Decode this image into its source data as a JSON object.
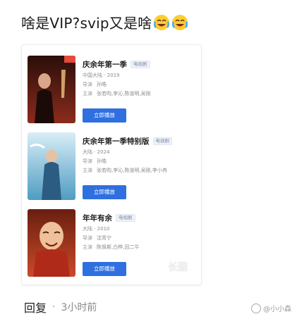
{
  "headline": "啥是VIP?svip又是啥",
  "items": [
    {
      "title": "庆余年第一季",
      "tag": "电视剧",
      "line1": "中国大陆 · 2019",
      "director_label": "导演",
      "director": "孙皓",
      "cast_label": "主演",
      "cast": "张若昀,李沁,陈道明,吴刚",
      "button": "立即播放",
      "poster_colors": [
        "#3a1410",
        "#7b2a1c"
      ]
    },
    {
      "title": "庆余年第一季特别版",
      "tag": "电视剧",
      "line1": "大陆 · 2024",
      "director_label": "导演",
      "director": "孙皓",
      "cast_label": "主演",
      "cast": "张若昀,李沁,陈道明,吴刚,李小冉",
      "button": "立即播放",
      "poster_colors": [
        "#cfe8f3",
        "#5ea7c9"
      ]
    },
    {
      "title": "年年有余",
      "tag": "电视剧",
      "line1": "大陆 · 2010",
      "director_label": "导演",
      "director": "沈青宁",
      "cast_label": "主演",
      "cast": "陈佩斯,白桦,田二牛",
      "button": "立即播放",
      "poster_colors": [
        "#7a2614",
        "#e9b08a"
      ]
    }
  ],
  "watermark_long": "长图",
  "reply": {
    "label": "回复",
    "separator": "·",
    "time": "3小时前"
  },
  "source_watermark": "@小小森"
}
